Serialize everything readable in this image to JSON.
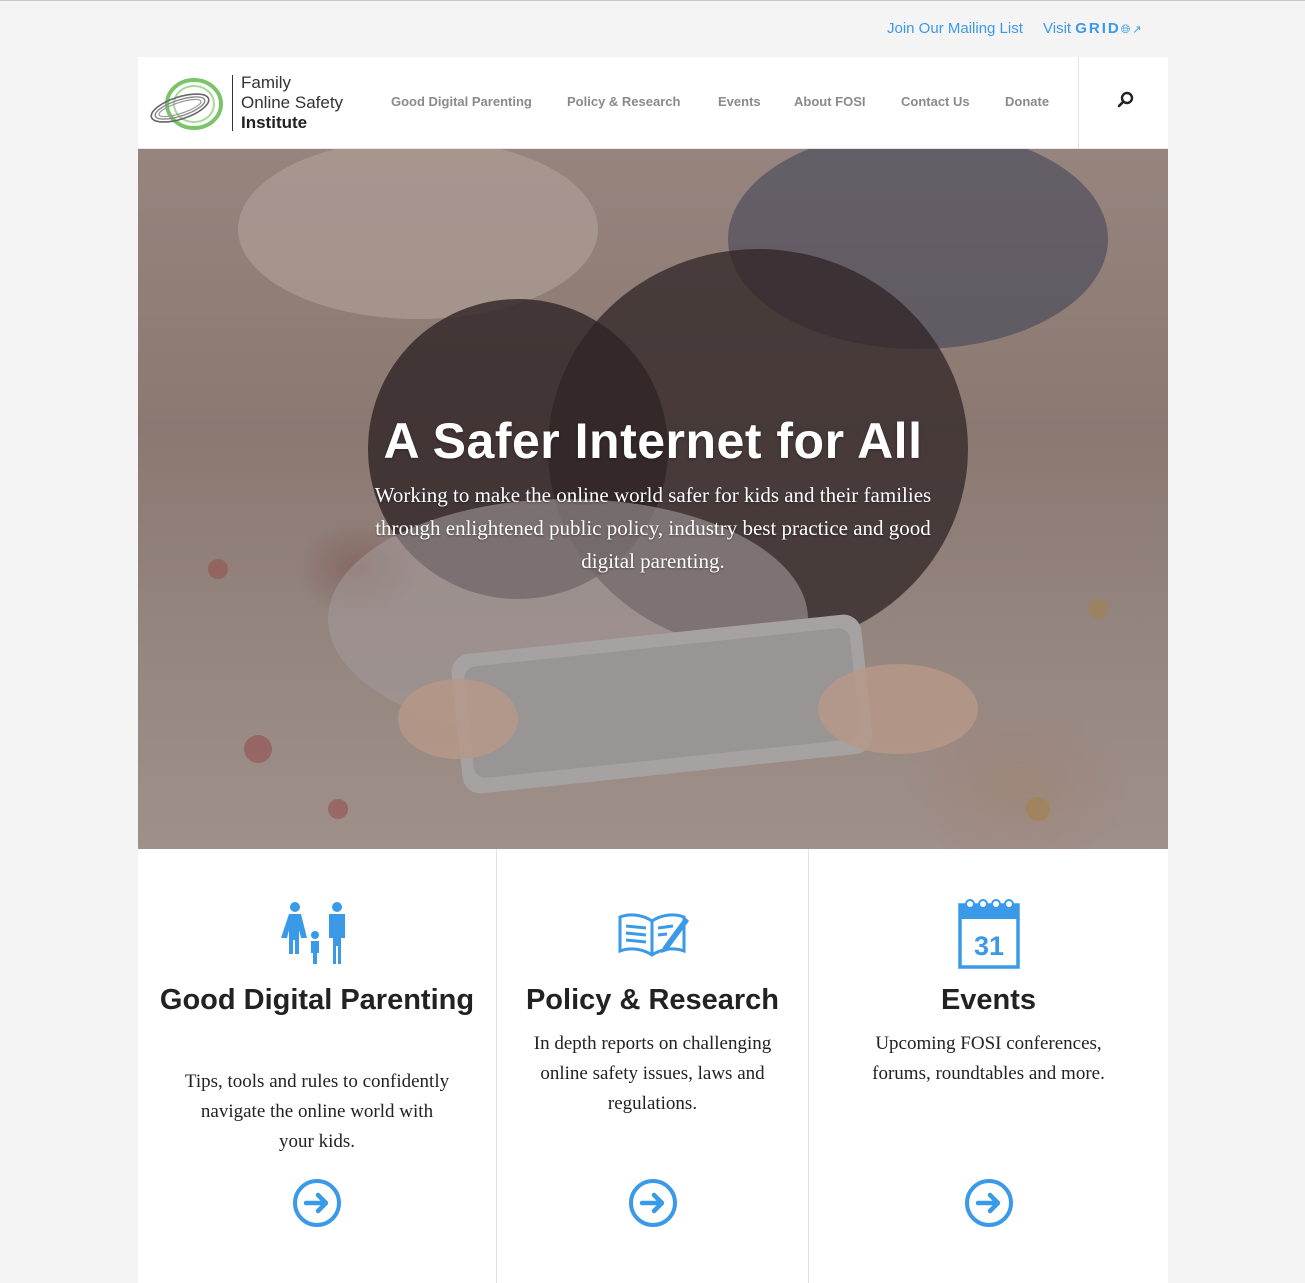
{
  "utility": {
    "mailing_list": "Join Our Mailing List",
    "visit": "Visit",
    "grid": "GRID"
  },
  "logo": {
    "line1": "Family",
    "line2": "Online Safety",
    "line3": "Institute"
  },
  "nav": {
    "items": [
      {
        "label": "Good Digital Parenting"
      },
      {
        "label": "Policy & Research"
      },
      {
        "label": "Events"
      },
      {
        "label": "About FOSI"
      },
      {
        "label": "Contact Us"
      },
      {
        "label": "Donate"
      }
    ]
  },
  "hero": {
    "title": "A Safer Internet for All",
    "subtitle": "Working to make the online world safer for kids and their families through enlightened public policy, industry best practice and good digital parenting."
  },
  "features": [
    {
      "title": "Good Digital Parenting",
      "text": "Tips, tools and rules to confidently navigate the online world with your kids.",
      "icon": "family-icon"
    },
    {
      "title": "Policy & Research",
      "text": "In depth reports on challenging online safety issues, laws and regulations.",
      "icon": "book-pencil-icon"
    },
    {
      "title": "Events",
      "text": "Upcoming FOSI conferences, forums, roundtables and more.",
      "icon": "calendar-icon",
      "calendar_day": "31"
    }
  ],
  "colors": {
    "accent": "#3a9ae8",
    "nav_text": "#8a8a8a",
    "heading": "#222222"
  }
}
